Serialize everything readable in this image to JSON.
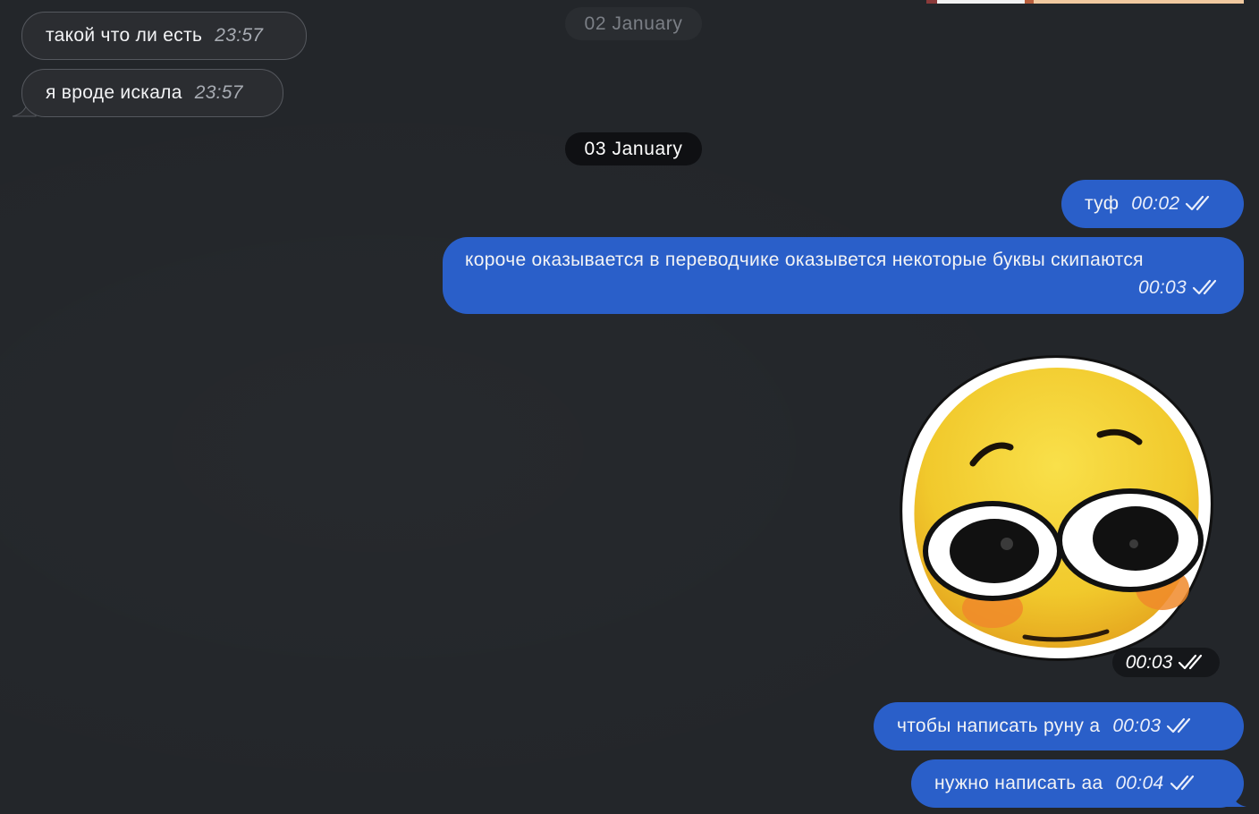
{
  "date_separators": [
    {
      "label": "02 January"
    },
    {
      "label": "03 January"
    }
  ],
  "messages": [
    {
      "direction": "incoming",
      "text": "такой что ли есть",
      "time": "23:57"
    },
    {
      "direction": "incoming",
      "text": "я вроде искала",
      "time": "23:57"
    },
    {
      "direction": "outgoing",
      "text": "туф",
      "time": "00:02",
      "status": "read"
    },
    {
      "direction": "outgoing",
      "text": "короче оказывается в переводчике оказывется некоторые буквы скипаются",
      "time": "00:03",
      "status": "read"
    },
    {
      "direction": "outgoing",
      "type": "sticker",
      "sticker": "shy-smiley-sticker",
      "time": "00:03",
      "status": "read"
    },
    {
      "direction": "outgoing",
      "text": "чтобы написать руну а",
      "time": "00:03",
      "status": "read"
    },
    {
      "direction": "outgoing",
      "text": "нужно написать аа",
      "time": "00:04",
      "status": "read"
    }
  ],
  "colors": {
    "background": "#23262a",
    "incoming_bubble": "#2b2d31",
    "outgoing_bubble": "#2a5fc9",
    "date_pill_active": "#0f1013"
  }
}
